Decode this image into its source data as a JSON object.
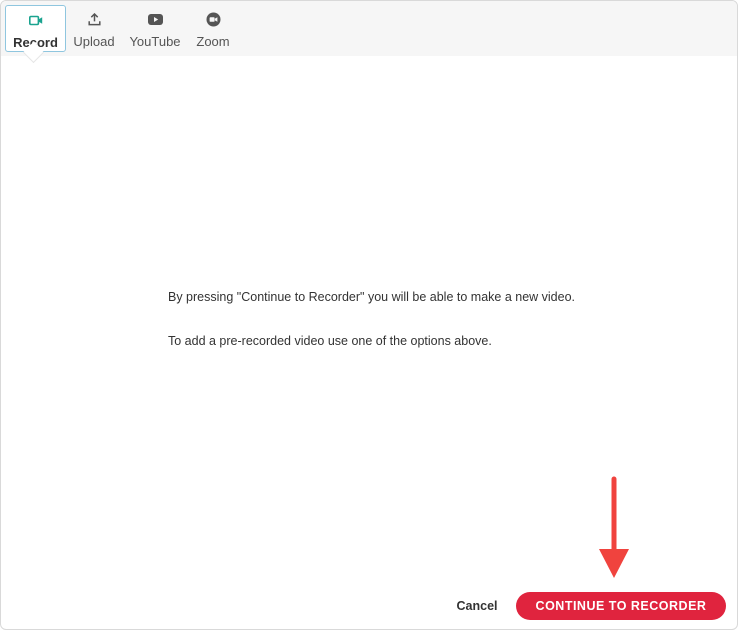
{
  "tabs": [
    {
      "id": "record",
      "label": "Record",
      "icon": "video-camera-icon",
      "active": true
    },
    {
      "id": "upload",
      "label": "Upload",
      "icon": "upload-icon",
      "active": false
    },
    {
      "id": "youtube",
      "label": "YouTube",
      "icon": "youtube-icon",
      "active": false
    },
    {
      "id": "zoom",
      "label": "Zoom",
      "icon": "zoom-icon",
      "active": false
    }
  ],
  "message": {
    "line1": "By pressing \"Continue to Recorder\" you will be able to make a new video.",
    "line2": "To add a pre-recorded video use one of the options above."
  },
  "actions": {
    "cancel_label": "Cancel",
    "continue_label": "CONTINUE TO RECORDER"
  },
  "colors": {
    "accent": "#1aa38f",
    "primary_button": "#e0243e",
    "annotation_arrow": "#f0433e",
    "active_tab_border": "#8fc6df"
  }
}
